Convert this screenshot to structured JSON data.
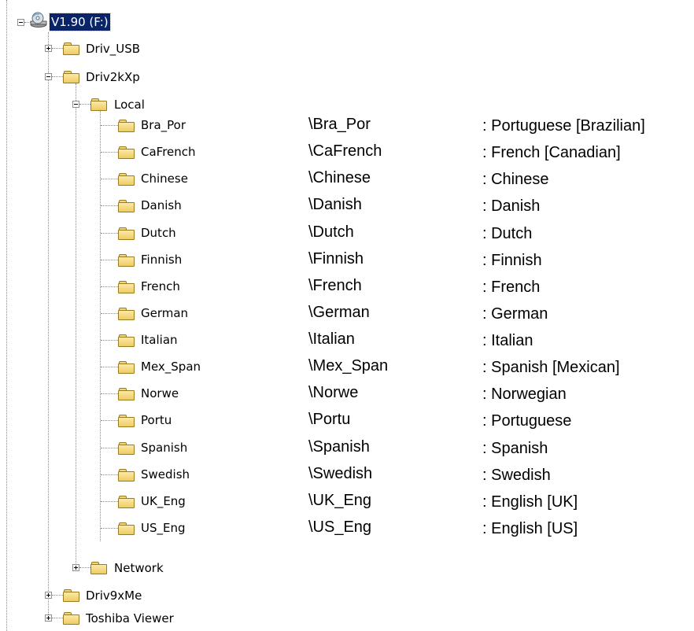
{
  "tree": {
    "drive": {
      "label": "V1.90 (F:)",
      "icon": "cd-drive-icon"
    },
    "children": [
      {
        "label": "Driv_USB",
        "expander": "plus"
      },
      {
        "label": "Driv2kXp",
        "expander": "minus"
      },
      {
        "label": "Local",
        "expander": "minus"
      },
      {
        "label": "Network",
        "expander": "plus"
      },
      {
        "label": "Driv9xMe",
        "expander": "plus"
      },
      {
        "label": "Toshiba Viewer",
        "expander": "plus"
      }
    ],
    "local_items": [
      {
        "folder": "Bra_Por",
        "path": "\\Bra_Por",
        "desc": ": Portuguese [Brazilian]"
      },
      {
        "folder": "CaFrench",
        "path": "\\CaFrench",
        "desc": ": French [Canadian]"
      },
      {
        "folder": "Chinese",
        "path": "\\Chinese",
        "desc": ": Chinese"
      },
      {
        "folder": "Danish",
        "path": "\\Danish",
        "desc": ": Danish"
      },
      {
        "folder": "Dutch",
        "path": "\\Dutch",
        "desc": ": Dutch"
      },
      {
        "folder": "Finnish",
        "path": "\\Finnish",
        "desc": ": Finnish"
      },
      {
        "folder": "French",
        "path": "\\French",
        "desc": ": French"
      },
      {
        "folder": "German",
        "path": "\\German",
        "desc": ": German"
      },
      {
        "folder": "Italian",
        "path": "\\Italian",
        "desc": ": Italian"
      },
      {
        "folder": "Mex_Span",
        "path": "\\Mex_Span",
        "desc": ": Spanish [Mexican]"
      },
      {
        "folder": "Norwe",
        "path": "\\Norwe",
        "desc": ": Norwegian"
      },
      {
        "folder": "Portu",
        "path": "\\Portu",
        "desc": ": Portuguese"
      },
      {
        "folder": "Spanish",
        "path": "\\Spanish",
        "desc": ": Spanish"
      },
      {
        "folder": "Swedish",
        "path": "\\Swedish",
        "desc": ": Swedish"
      },
      {
        "folder": "UK_Eng",
        "path": "\\UK_Eng",
        "desc": ": English [UK]"
      },
      {
        "folder": "US_Eng",
        "path": "\\US_Eng",
        "desc": ": English [US]"
      }
    ]
  },
  "colors": {
    "selection": "#0a246a",
    "folder": "#efcc63",
    "tree_lines": "#8a8a8a"
  }
}
